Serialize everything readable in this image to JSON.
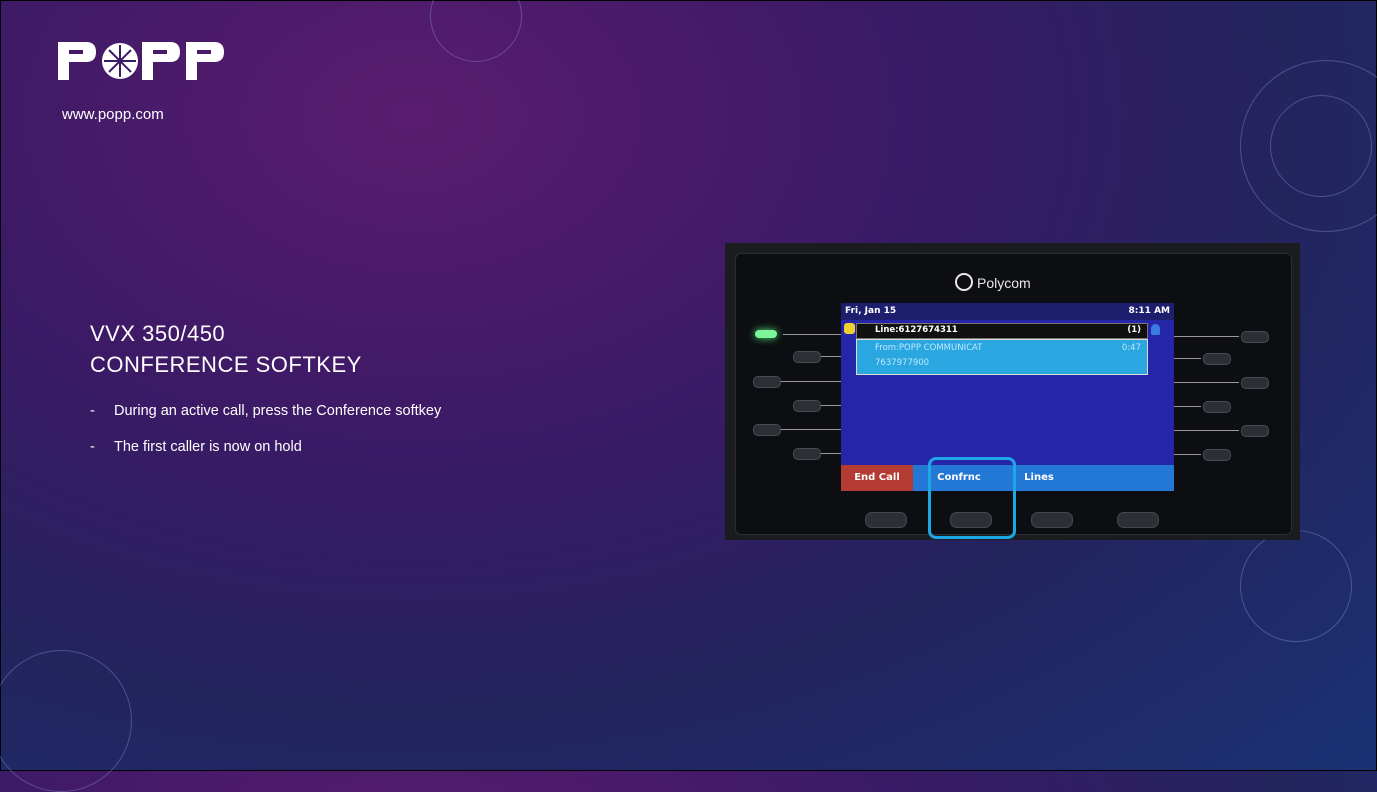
{
  "logo": {
    "text": "POPP",
    "url": "www.popp.com"
  },
  "title": {
    "line1": "VVX 350/450",
    "line2": "CONFERENCE SOFTKEY"
  },
  "bullets": [
    "During an active call, press the Conference softkey",
    "The first caller is now on hold"
  ],
  "bullet_marker": "-",
  "phone": {
    "brand": "Polycom",
    "screen": {
      "date": "Fri, Jan 15",
      "time": "8:11 AM",
      "line": "Line:6127674311",
      "line_count": "(1)",
      "from": "From:POPP COMMUNICAT",
      "duration": "0:47",
      "number": "7637977900",
      "softkeys": [
        "End Call",
        "Confrnc",
        "Lines"
      ]
    }
  },
  "colors": {
    "accent": "#1ea7e6",
    "end_call": "#b43b32",
    "softbar": "#2378d6"
  }
}
